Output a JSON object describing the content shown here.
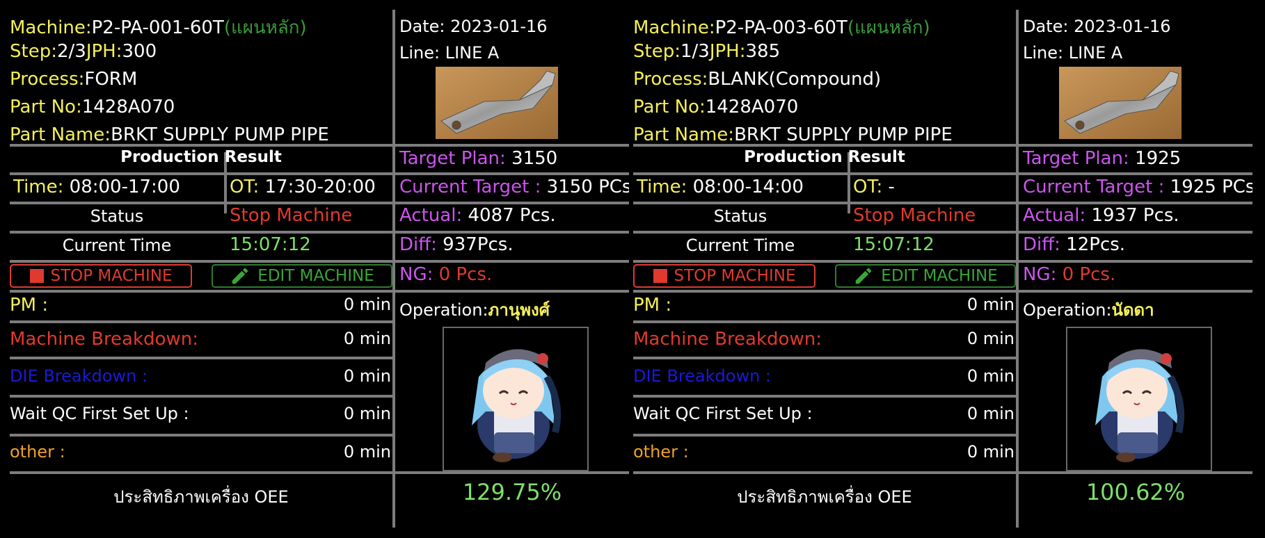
{
  "panels": [
    {
      "machine_label": "Machine:",
      "machine_value": "P2-PA-001-60T",
      "machine_type": "(แผนหลัก)",
      "step_label": "Step:",
      "step_value": "2/3",
      "jph_label": "JPH:",
      "jph_value": "300",
      "process_label": "Process:",
      "process_value": "FORM",
      "partno_label": "Part No:",
      "partno_value": "1428A070",
      "partname_label": "Part Name:",
      "partname_value": "BRKT SUPPLY PUMP PIPE",
      "date_text": "Date: 2023-01-16",
      "line_text": "Line: LINE A",
      "production_title": "Production Result",
      "time_label": "Time:",
      "time_value": " 08:00-17:00",
      "ot_label": "OT:",
      "ot_value": " 17:30-20:00",
      "status_label": "Status",
      "status_value": "Stop Machine",
      "current_time_label": "Current Time",
      "current_time_value": "15:07:12",
      "stop_button": "STOP MACHINE",
      "edit_button": "EDIT MACHINE",
      "target_plan_label": "Target Plan:",
      "target_plan_value": " 3150",
      "current_target_label": "Current Target :",
      "current_target_value": " 3150 PCs",
      "actual_label": "Actual:",
      "actual_value": " 4087 Pcs.",
      "diff_label": "Diff:",
      "diff_value": "  937Pcs.",
      "ng_label": "NG:",
      "ng_value": " 0 Pcs.",
      "operation_label": "Operation:",
      "operation_value": "ภานุพงศ์",
      "pm_label": "PM :",
      "pm_value": "0 min",
      "breakdown_label": "Machine Breakdown:",
      "breakdown_value": "0 min",
      "die_label": "DIE Breakdown :",
      "die_value": "0 min",
      "qc_label": "Wait QC First Set Up :",
      "qc_value": "0 min",
      "other_label": "other :",
      "other_value": "0 min",
      "oee_label": "ประสิทธิภาพเครื่อง OEE",
      "oee_value": "129.75%"
    },
    {
      "machine_label": "Machine:",
      "machine_value": "P2-PA-003-60T",
      "machine_type": "(แผนหลัก)",
      "step_label": "Step:",
      "step_value": "1/3",
      "jph_label": "JPH:",
      "jph_value": "385",
      "process_label": "Process:",
      "process_value": "BLANK(Compound)",
      "partno_label": "Part No:",
      "partno_value": "1428A070",
      "partname_label": "Part Name:",
      "partname_value": "BRKT SUPPLY PUMP PIPE",
      "date_text": "Date: 2023-01-16",
      "line_text": "Line: LINE A",
      "production_title": "Production Result",
      "time_label": "Time:",
      "time_value": " 08:00-14:00",
      "ot_label": "OT:",
      "ot_value": " -",
      "status_label": "Status",
      "status_value": "Stop Machine",
      "current_time_label": "Current Time",
      "current_time_value": "15:07:12",
      "stop_button": "STOP MACHINE",
      "edit_button": "EDIT MACHINE",
      "target_plan_label": "Target Plan:",
      "target_plan_value": " 1925",
      "current_target_label": "Current Target :",
      "current_target_value": " 1925 PCs.",
      "actual_label": "Actual:",
      "actual_value": " 1937 Pcs.",
      "diff_label": "Diff:",
      "diff_value": "  12Pcs.",
      "ng_label": "NG:",
      "ng_value": " 0 Pcs.",
      "operation_label": "Operation:",
      "operation_value": "นัดดา",
      "pm_label": "PM :",
      "pm_value": "0 min",
      "breakdown_label": "Machine Breakdown:",
      "breakdown_value": "0 min",
      "die_label": "DIE Breakdown :",
      "die_value": "0 min",
      "qc_label": "Wait QC First Set Up :",
      "qc_value": "0 min",
      "other_label": "other :",
      "other_value": "0 min",
      "oee_label": "ประสิทธิภาพเครื่อง OEE",
      "oee_value": "100.62%"
    }
  ],
  "colors": {
    "label_yellow": "#f5f05a",
    "type_green": "#3a9a3a",
    "magenta": "#cc55ee",
    "red": "#e03a2f",
    "blue": "#1a1ad8",
    "orange": "#f0a030",
    "oee_green": "#7de06a",
    "grid_gray": "#7d7d7d"
  },
  "icons": [
    "stop-square-icon",
    "pencil-edit-icon"
  ]
}
